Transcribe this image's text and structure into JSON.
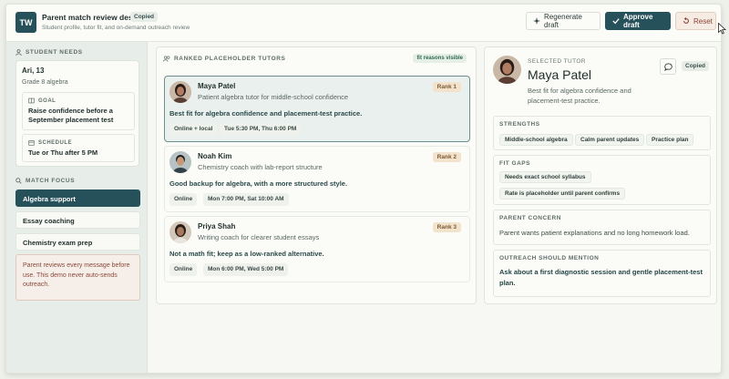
{
  "app": {
    "logo": "TW",
    "title": "Parent match review desk",
    "copied": "Copied",
    "subtitle": "Student profile, tutor fit, and on-demand outreach review"
  },
  "toolbar": {
    "regenerate_label": "Regenerate draft",
    "approve_label": "Approve draft",
    "reset_label": "Reset"
  },
  "sidebar": {
    "student_needs_label": "STUDENT NEEDS",
    "student": {
      "name": "Ari, 13",
      "grade": "Grade 8 algebra",
      "goal_label": "GOAL",
      "goal": "Raise confidence before a September placement test",
      "schedule_label": "SCHEDULE",
      "schedule": "Tue or Thu after 5 PM"
    },
    "match_focus_label": "MATCH FOCUS",
    "focus_items": [
      {
        "label": "Algebra support",
        "active": true
      },
      {
        "label": "Essay coaching",
        "active": false
      },
      {
        "label": "Chemistry exam prep",
        "active": false
      }
    ],
    "notice": "Parent reviews every message before use. This demo never auto-sends outreach."
  },
  "tutors_panel": {
    "label": "RANKED PLACEHOLDER TUTORS",
    "badge": "fit reasons visible",
    "tutors": [
      {
        "name": "Maya Patel",
        "desc": "Patient algebra tutor for middle-school confidence",
        "rank": "Rank 1",
        "fit": "Best fit for algebra confidence and placement-test practice.",
        "chips": [
          "Online + local",
          "Tue 5:30 PM, Thu 6:00 PM"
        ]
      },
      {
        "name": "Noah Kim",
        "desc": "Chemistry coach with lab-report structure",
        "rank": "Rank 2",
        "fit": "Good backup for algebra, with a more structured style.",
        "chips": [
          "Online",
          "Mon 7:00 PM, Sat 10:00 AM"
        ]
      },
      {
        "name": "Priya Shah",
        "desc": "Writing coach for clearer student essays",
        "rank": "Rank 3",
        "fit": "Not a math fit; keep as a low-ranked alternative.",
        "chips": [
          "Online",
          "Mon 6:00 PM, Wed 5:00 PM"
        ]
      }
    ]
  },
  "selected": {
    "label": "SELECTED TUTOR",
    "name": "Maya Patel",
    "desc": "Best fit for algebra confidence and placement-test practice.",
    "copied": "Copied",
    "strengths_label": "STRENGTHS",
    "strengths": [
      "Middle-school algebra",
      "Calm parent updates",
      "Practice plan"
    ],
    "fit_gaps_label": "FIT GAPS",
    "fit_gaps": [
      "Needs exact school syllabus",
      "Rate is placeholder until parent confirms"
    ],
    "concern_label": "PARENT CONCERN",
    "concern": "Parent wants patient explanations and no long homework load.",
    "outreach_label": "OUTREACH SHOULD MENTION",
    "outreach": "Ask about a first diagnostic session and gentle placement-test plan."
  }
}
